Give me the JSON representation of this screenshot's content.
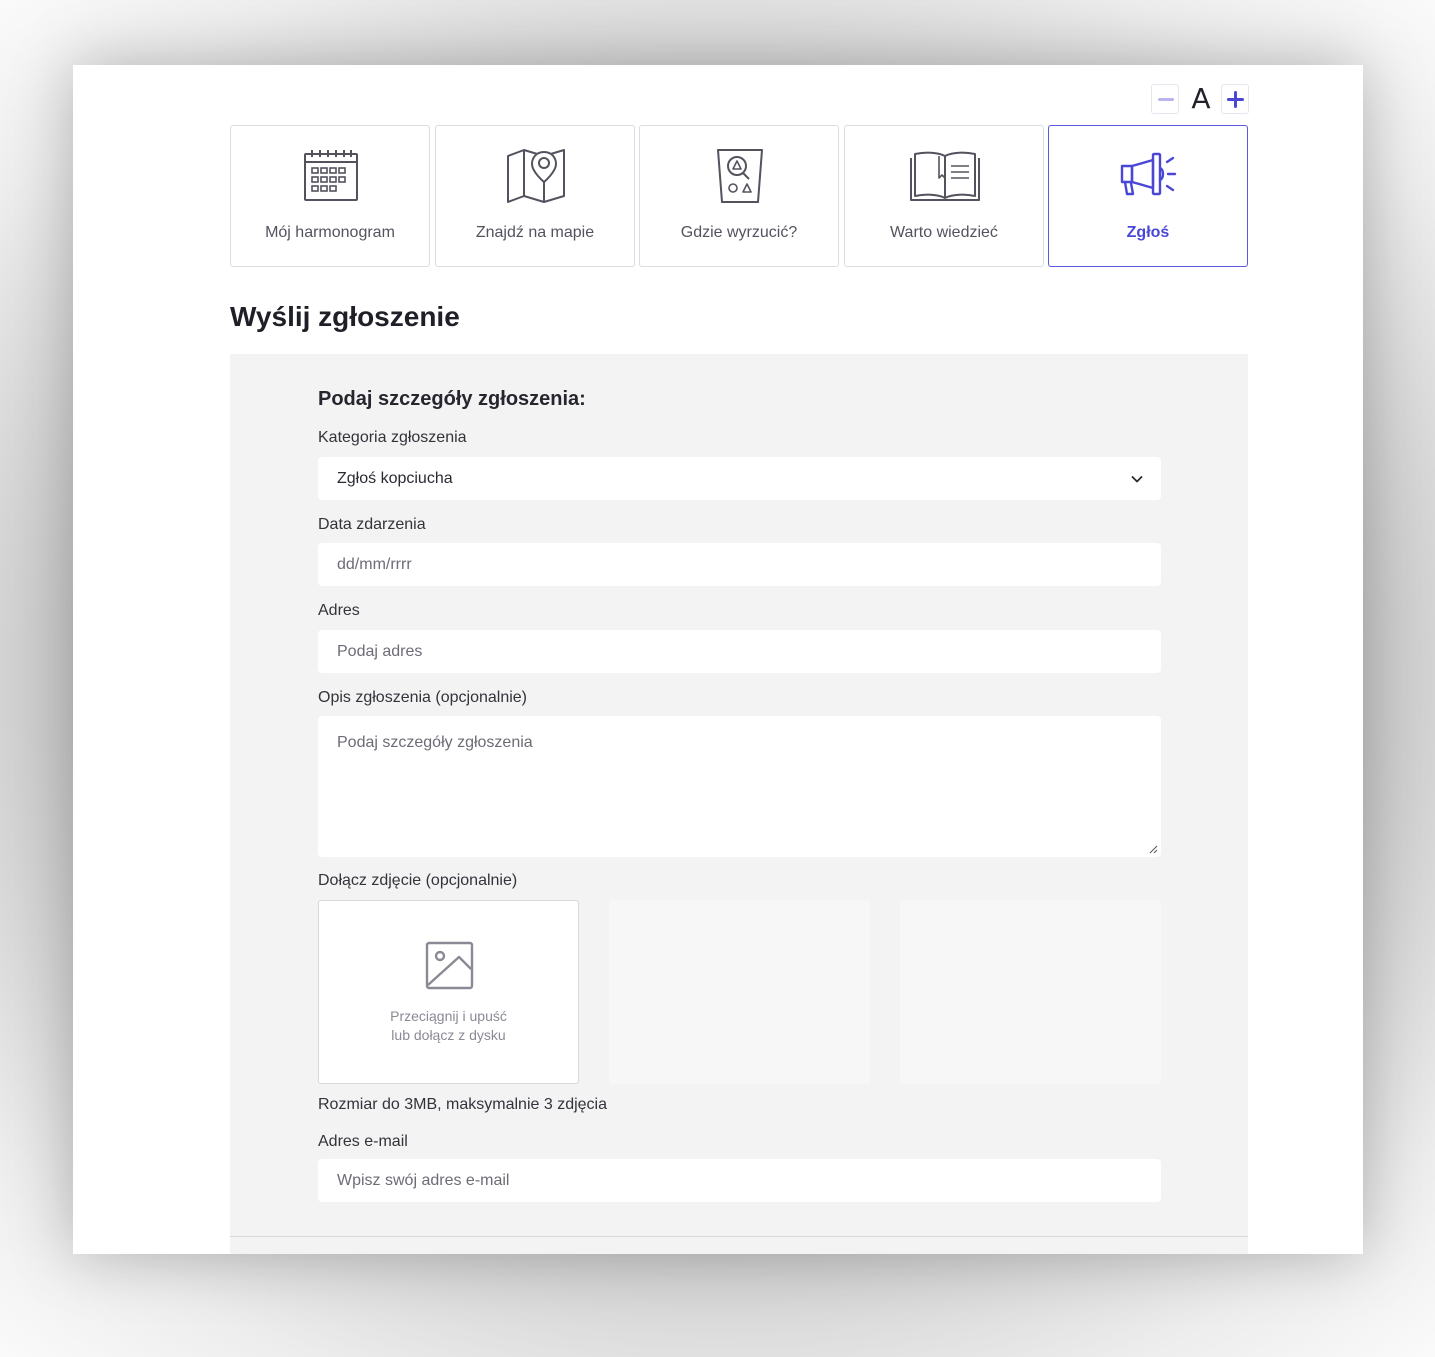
{
  "font_controls": {
    "a_label": "A"
  },
  "nav": {
    "tiles": [
      {
        "label": "Mój harmonogram",
        "icon": "calendar-icon"
      },
      {
        "label": "Znajdź na mapie",
        "icon": "map-icon"
      },
      {
        "label": "Gdzie wyrzucić?",
        "icon": "waste-bin-icon"
      },
      {
        "label": "Warto wiedzieć",
        "icon": "book-icon"
      },
      {
        "label": "Zgłoś",
        "icon": "megaphone-icon",
        "active": true
      }
    ]
  },
  "page": {
    "title": "Wyślij zgłoszenie"
  },
  "form": {
    "section_title": "Podaj szczegóły zgłoszenia:",
    "category": {
      "label": "Kategoria zgłoszenia",
      "value": "Zgłoś kopciucha"
    },
    "date": {
      "label": "Data zdarzenia",
      "placeholder": "dd/mm/rrrr"
    },
    "address": {
      "label": "Adres",
      "placeholder": "Podaj adres"
    },
    "description": {
      "label": "Opis zgłoszenia (opcjonalnie)",
      "placeholder": "Podaj szczegóły zgłoszenia"
    },
    "photo": {
      "label": "Dołącz zdjęcie (opcjonalnie)",
      "drop_line1": "Przeciągnij i upuść",
      "drop_line2": "lub dołącz z dysku",
      "hint": "Rozmiar do 3MB, maksymalnie 3 zdjęcia"
    },
    "email": {
      "label": "Adres e-mail",
      "placeholder": "Wpisz swój adres e-mail"
    }
  },
  "colors": {
    "accent": "#4b47d6",
    "icon": "#55525e",
    "panel": "#f3f3f3"
  }
}
